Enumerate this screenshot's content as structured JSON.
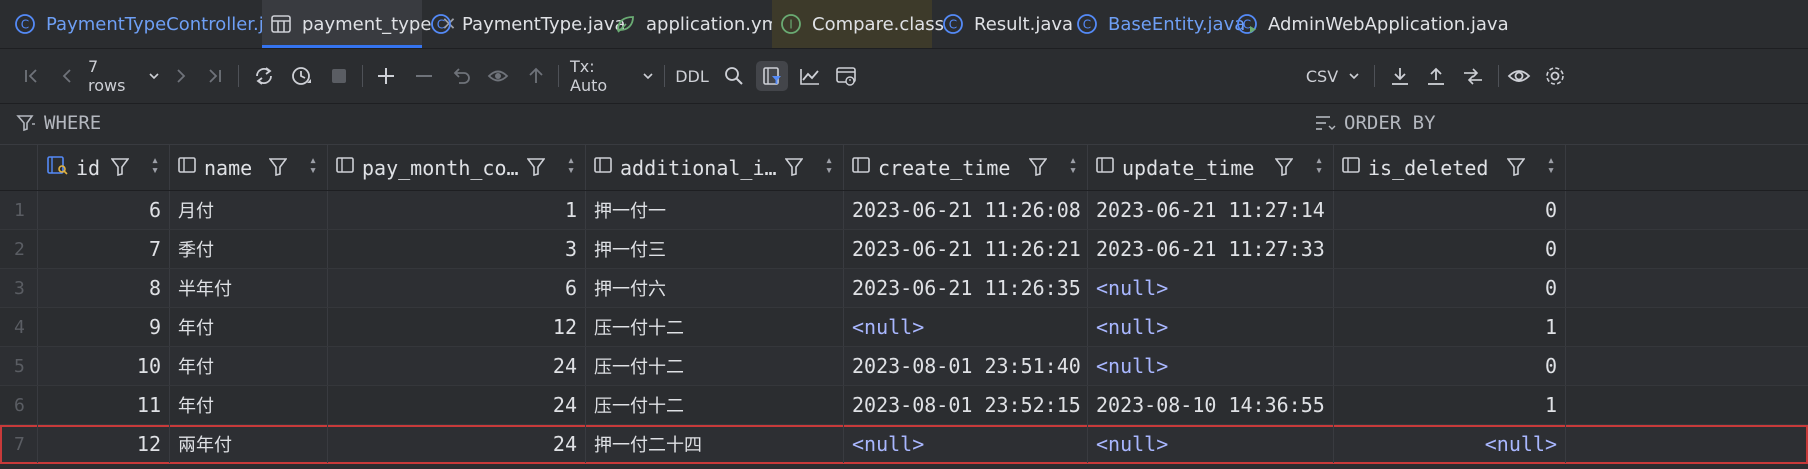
{
  "tabs": [
    {
      "label": "PaymentTypeController.java",
      "icon": "java-class-icon"
    },
    {
      "label": "payment_type",
      "icon": "table-icon",
      "active": true
    },
    {
      "label": "PaymentType.java",
      "icon": "java-class-icon"
    },
    {
      "label": "application.yml",
      "icon": "yaml-leaf-icon"
    },
    {
      "label": "Compare.class",
      "icon": "interface-icon"
    },
    {
      "label": "Result.java",
      "icon": "java-class-icon"
    },
    {
      "label": "BaseEntity.java",
      "icon": "java-class-icon"
    },
    {
      "label": "AdminWebApplication.java",
      "icon": "java-app-icon"
    }
  ],
  "toolbar": {
    "rows_label": "7 rows",
    "tx_label": "Tx: Auto",
    "ddl_label": "DDL",
    "export_format": "CSV"
  },
  "filters": {
    "where_label": "WHERE",
    "order_label": "ORDER BY"
  },
  "columns": [
    {
      "name": "id",
      "icon": "primary-key-icon"
    },
    {
      "name": "name",
      "icon": "column-icon"
    },
    {
      "name": "pay_month_co…",
      "icon": "column-icon"
    },
    {
      "name": "additional_i…",
      "icon": "column-icon"
    },
    {
      "name": "create_time",
      "icon": "column-icon"
    },
    {
      "name": "update_time",
      "icon": "column-icon"
    },
    {
      "name": "is_deleted",
      "icon": "column-icon"
    }
  ],
  "rows": [
    {
      "n": "1",
      "id": "6",
      "name": "月付",
      "pay": "1",
      "add": "押一付一",
      "create": "2023-06-21 11:26:08",
      "update": "2023-06-21 11:27:14",
      "del": "0"
    },
    {
      "n": "2",
      "id": "7",
      "name": "季付",
      "pay": "3",
      "add": "押一付三",
      "create": "2023-06-21 11:26:21",
      "update": "2023-06-21 11:27:33",
      "del": "0"
    },
    {
      "n": "3",
      "id": "8",
      "name": "半年付",
      "pay": "6",
      "add": "押一付六",
      "create": "2023-06-21 11:26:35",
      "update": "<null>",
      "del": "0"
    },
    {
      "n": "4",
      "id": "9",
      "name": "年付",
      "pay": "12",
      "add": "压一付十二",
      "create": "<null>",
      "update": "<null>",
      "del": "1"
    },
    {
      "n": "5",
      "id": "10",
      "name": "年付",
      "pay": "24",
      "add": "压一付十二",
      "create": "2023-08-01 23:51:40",
      "update": "<null>",
      "del": "0"
    },
    {
      "n": "6",
      "id": "11",
      "name": "年付",
      "pay": "24",
      "add": "压一付十二",
      "create": "2023-08-01 23:52:15",
      "update": "2023-08-10 14:36:55",
      "del": "1"
    },
    {
      "n": "7",
      "id": "12",
      "name": "兩年付",
      "pay": "24",
      "add": "押一付二十四",
      "create": "<null>",
      "update": "<null>",
      "del": "<null>"
    }
  ],
  "colors": {
    "accent": "#3574f0",
    "null_text": "#a9b7ff",
    "selection_border": "#c73a3a"
  }
}
